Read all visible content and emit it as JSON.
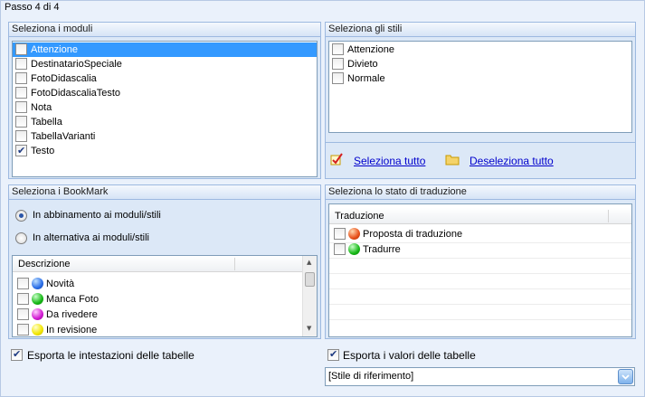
{
  "step_label": "Passo 4 di 4",
  "modules": {
    "title": "Seleziona i moduli",
    "items": [
      {
        "label": "Attenzione",
        "checked": false,
        "selected": true
      },
      {
        "label": "DestinatarioSpeciale",
        "checked": false
      },
      {
        "label": "FotoDidascalia",
        "checked": false
      },
      {
        "label": "FotoDidascaliaTesto",
        "checked": false
      },
      {
        "label": "Nota",
        "checked": false
      },
      {
        "label": "Tabella",
        "checked": false
      },
      {
        "label": "TabellaVarianti",
        "checked": false
      },
      {
        "label": "Testo",
        "checked": true
      }
    ]
  },
  "styles": {
    "title": "Seleziona gli stili",
    "items": [
      {
        "label": "Attenzione",
        "checked": false
      },
      {
        "label": "Divieto",
        "checked": false
      },
      {
        "label": "Normale",
        "checked": false
      }
    ],
    "select_all": "Seleziona tutto",
    "deselect_all": "Deseleziona tutto"
  },
  "bookmark": {
    "title": "Seleziona i BookMark",
    "radio1": "In abbinamento ai moduli/stili",
    "radio2": "In alternativa ai moduli/stili",
    "column": "Descrizione",
    "items": [
      {
        "label": "Novità",
        "color": "blue-ball-icon"
      },
      {
        "label": "Manca Foto",
        "color": "green-ball-icon"
      },
      {
        "label": "Da rivedere",
        "color": "magenta-ball-icon"
      },
      {
        "label": "In revisione",
        "color": "yellow-ball-icon"
      }
    ]
  },
  "translation": {
    "title": "Seleziona lo stato di traduzione",
    "column": "Traduzione",
    "items": [
      {
        "label": "Proposta di traduzione",
        "icon": "red-arrows-icon"
      },
      {
        "label": "Tradurre",
        "icon": "green-arrows-icon"
      }
    ]
  },
  "footer": {
    "export_headers": "Esporta le intestazioni delle tabelle",
    "export_values": "Esporta i valori delle tabelle",
    "style_combo": "[Stile di riferimento]"
  },
  "colors": {
    "blue": "#2a6ee8",
    "green": "#16b816",
    "magenta": "#d21ad2",
    "yellow": "#f2e600",
    "selection": "#3399ff"
  }
}
